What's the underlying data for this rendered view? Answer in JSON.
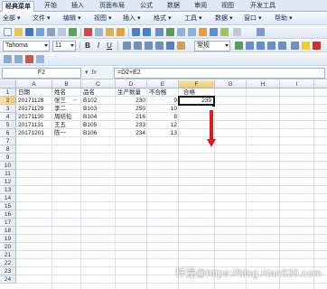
{
  "ribbon_tabs": [
    {
      "label": "经典菜单",
      "active": true
    },
    {
      "label": "开始",
      "active": false
    },
    {
      "label": "插入",
      "active": false
    },
    {
      "label": "页面布局",
      "active": false
    },
    {
      "label": "公式",
      "active": false
    },
    {
      "label": "数据",
      "active": false
    },
    {
      "label": "审阅",
      "active": false
    },
    {
      "label": "视图",
      "active": false
    },
    {
      "label": "开发工具",
      "active": false
    }
  ],
  "menu_items": [
    "全部",
    "文件",
    "编辑",
    "视图",
    "插入",
    "格式",
    "工具",
    "数据",
    "窗口",
    "帮助"
  ],
  "font": {
    "name": "Tahoma",
    "size": "11",
    "style_box": "常规"
  },
  "format_buttons": {
    "bold": "B",
    "italic": "I",
    "underline": "U"
  },
  "namebox": "F2",
  "fx_label": "fx",
  "formula": "=D2+E2",
  "columns": [
    "A",
    "B",
    "C",
    "D",
    "E",
    "F",
    "G",
    "H",
    "I"
  ],
  "selected_column": "F",
  "rows": [
    "1",
    "2",
    "3",
    "4",
    "5",
    "6",
    "7",
    "8",
    "9",
    "10",
    "11",
    "12",
    "13",
    "14",
    "15",
    "16",
    "17",
    "18",
    "19",
    "20",
    "21",
    "22",
    "23",
    "24"
  ],
  "selected_row": "2",
  "table": {
    "headers": [
      "日期",
      "姓名",
      "品名",
      "生产数量",
      "不合格",
      "合格"
    ],
    "data": [
      [
        "20171128",
        "张三",
        "B102",
        "230",
        "9",
        "239"
      ],
      [
        "20171129",
        "李二",
        "B103",
        "250",
        "10",
        ""
      ],
      [
        "20171130",
        "周结伦",
        "B104",
        "216",
        "8",
        ""
      ],
      [
        "20171131",
        "王五",
        "B105",
        "233",
        "12",
        ""
      ],
      [
        "20171201",
        "陈一",
        "B106",
        "234",
        "13",
        ""
      ]
    ]
  },
  "annotation_color": "#e01a1a",
  "watermark": "梓潼@https://blog.ntan520.com"
}
